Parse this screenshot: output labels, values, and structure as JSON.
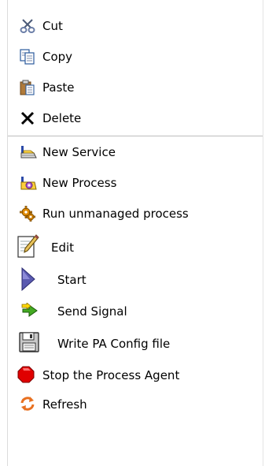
{
  "menu": {
    "items": [
      {
        "label": "Cut",
        "icon": "scissors-icon"
      },
      {
        "label": "Copy",
        "icon": "copy-icon"
      },
      {
        "label": "Paste",
        "icon": "paste-icon"
      },
      {
        "label": "Delete",
        "icon": "delete-x-icon"
      },
      {
        "label": "New Service",
        "icon": "new-service-icon"
      },
      {
        "label": "New Process",
        "icon": "new-process-icon"
      },
      {
        "label": "Run unmanaged process",
        "icon": "gear-icon"
      },
      {
        "label": "Edit",
        "icon": "edit-pencil-icon"
      },
      {
        "label": "Start",
        "icon": "start-triangle-icon"
      },
      {
        "label": "Send Signal",
        "icon": "signal-arrow-icon"
      },
      {
        "label": "Write PA Config file",
        "icon": "floppy-disk-icon"
      },
      {
        "label": "Stop the Process Agent",
        "icon": "stop-red-icon"
      },
      {
        "label": "Refresh",
        "icon": "refresh-icon"
      }
    ]
  },
  "colors": {
    "separator": "#bdbdbd",
    "stop_red": "#e00000",
    "start_blue": "#5a5ab0",
    "signal_green": "#44aa22",
    "signal_yellow": "#ffd800",
    "gear_orange": "#e08a00",
    "refresh_orange": "#e87020"
  }
}
